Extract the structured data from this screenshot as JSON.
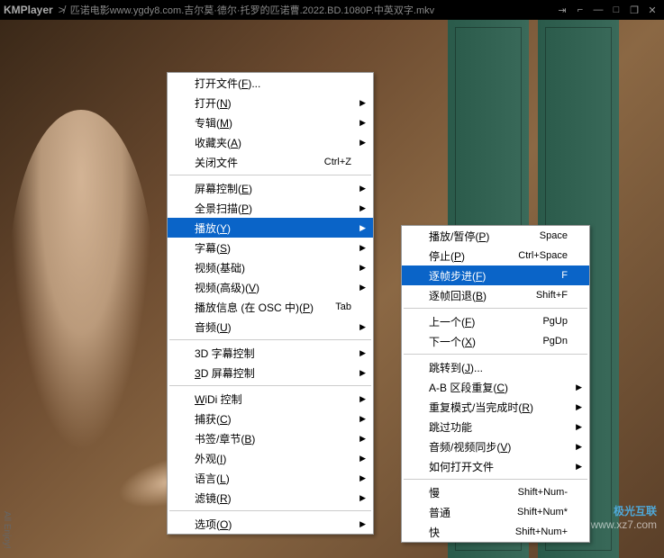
{
  "titlebar": {
    "logo": "KMPlayer",
    "file": "匹诺电影www.ygdy8.com.吉尔莫·德尔·托罗的匹诺曹.2022.BD.1080P.中英双字.mkv"
  },
  "watermark": {
    "cn": "极光互联",
    "url": "www.xz7.com"
  },
  "vertical": "All Enjoy!",
  "main_menu": [
    {
      "t": "item",
      "label": "打开文件(F)...",
      "u": "F"
    },
    {
      "t": "item",
      "label": "打开(N)",
      "u": "N",
      "arrow": true
    },
    {
      "t": "item",
      "label": "专辑(M)",
      "u": "M",
      "arrow": true
    },
    {
      "t": "item",
      "label": "收藏夹(A)",
      "u": "A",
      "arrow": true
    },
    {
      "t": "item",
      "label": "关闭文件",
      "shortcut": "Ctrl+Z"
    },
    {
      "t": "sep"
    },
    {
      "t": "item",
      "label": "屏幕控制(E)",
      "u": "E",
      "arrow": true
    },
    {
      "t": "item",
      "label": "全景扫描(P)",
      "u": "P",
      "arrow": true
    },
    {
      "t": "item",
      "label": "播放(Y)",
      "u": "Y",
      "arrow": true,
      "hl": true
    },
    {
      "t": "item",
      "label": "字幕(S)",
      "u": "S",
      "arrow": true
    },
    {
      "t": "item",
      "label": "视频(基础)",
      "arrow": true
    },
    {
      "t": "item",
      "label": "视频(高级)(V)",
      "u": "V",
      "arrow": true
    },
    {
      "t": "item",
      "label": "播放信息 (在 OSC 中)(P)",
      "u": "P",
      "shortcut": "Tab"
    },
    {
      "t": "item",
      "label": "音频(U)",
      "u": "U",
      "arrow": true
    },
    {
      "t": "sep"
    },
    {
      "t": "item",
      "label": "3D 字幕控制",
      "arrow": true
    },
    {
      "t": "item",
      "label": "3D 屏幕控制",
      "u": "3",
      "arrow": true
    },
    {
      "t": "sep"
    },
    {
      "t": "item",
      "label": "WiDi 控制",
      "u": "W",
      "arrow": true
    },
    {
      "t": "item",
      "label": "捕获(C)",
      "u": "C",
      "arrow": true
    },
    {
      "t": "item",
      "label": "书签/章节(B)",
      "u": "B",
      "arrow": true
    },
    {
      "t": "item",
      "label": "外观(I)",
      "u": "I",
      "arrow": true
    },
    {
      "t": "item",
      "label": "语言(L)",
      "u": "L",
      "arrow": true
    },
    {
      "t": "item",
      "label": "滤镜(R)",
      "u": "R",
      "arrow": true
    },
    {
      "t": "sep"
    },
    {
      "t": "item",
      "label": "选项(O)",
      "u": "O",
      "arrow": true
    }
  ],
  "sub_menu": [
    {
      "t": "item",
      "label": "播放/暂停(P)",
      "u": "P",
      "shortcut": "Space"
    },
    {
      "t": "item",
      "label": "停止(P)",
      "u": "P",
      "shortcut": "Ctrl+Space"
    },
    {
      "t": "item",
      "label": "逐帧步进(F)",
      "u": "F",
      "shortcut": "F",
      "hl": true
    },
    {
      "t": "item",
      "label": "逐帧回退(B)",
      "u": "B",
      "shortcut": "Shift+F"
    },
    {
      "t": "sep"
    },
    {
      "t": "item",
      "label": "上一个(F)",
      "u": "F",
      "shortcut": "PgUp"
    },
    {
      "t": "item",
      "label": "下一个(X)",
      "u": "X",
      "shortcut": "PgDn"
    },
    {
      "t": "sep"
    },
    {
      "t": "item",
      "label": "跳转到(J)...",
      "u": "J"
    },
    {
      "t": "item",
      "label": "A-B 区段重复(C)",
      "u": "C",
      "arrow": true
    },
    {
      "t": "item",
      "label": "重复模式/当完成时(R)",
      "u": "R",
      "arrow": true
    },
    {
      "t": "item",
      "label": "跳过功能",
      "arrow": true
    },
    {
      "t": "item",
      "label": "音频/视频同步(V)",
      "u": "V",
      "arrow": true
    },
    {
      "t": "item",
      "label": "如何打开文件",
      "arrow": true
    },
    {
      "t": "sep"
    },
    {
      "t": "item",
      "label": "慢",
      "shortcut": "Shift+Num-"
    },
    {
      "t": "item",
      "label": "普通",
      "shortcut": "Shift+Num*"
    },
    {
      "t": "item",
      "label": "快",
      "shortcut": "Shift+Num+"
    }
  ]
}
